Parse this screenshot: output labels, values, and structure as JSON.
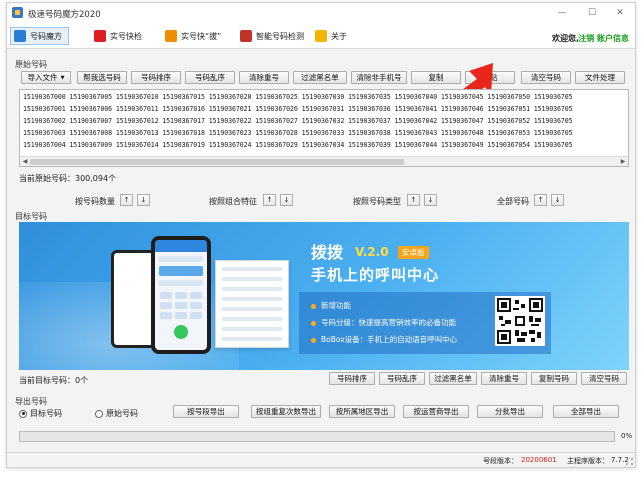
{
  "window": {
    "title": "极速号码魔方2020",
    "controls": [
      "—",
      "☐",
      "✕"
    ]
  },
  "tabs": [
    {
      "label": "号码魔方",
      "icon": "cube-icon",
      "color": "#2b7cd3",
      "active": true
    },
    {
      "label": "实号快检",
      "icon": "phone-check-icon",
      "color": "#e02020",
      "active": false
    },
    {
      "label": "实号快“拔”",
      "icon": "pull-icon",
      "color": "#f08c00",
      "active": false
    },
    {
      "label": "智能号码检测",
      "icon": "hourglass-icon",
      "color": "#c0332b",
      "active": false
    },
    {
      "label": "关于",
      "icon": "info-icon",
      "color": "#f2b600",
      "active": false
    }
  ],
  "header": {
    "welcome": "欢迎您,",
    "register": "注销 账户信息"
  },
  "original": {
    "group_label": "原始号码",
    "buttons": [
      "导入文件",
      "帮我选号码",
      "号码排序",
      "号码乱序",
      "清除重号",
      "过滤黑名单",
      "清除非手机号",
      "复制",
      "粘贴",
      "清空号码",
      "文件处理"
    ],
    "rows": [
      "15190367000 15190367005 15190367010 15190367015 15190367020 15190367025 15190367030 15190367035 15190367040 15190367045 15190367050 1519036705",
      "15190367001 15190367006 15190367011 15190367016 15190367021 15190367026 15190367031 15190367036 15190367041 15190367046 15190367051 1519036705",
      "15190367002 15190367007 15190367012 15190367017 15190367022 15190367027 15190367032 15190367037 15190367042 15190367047 15190367052 1519036705",
      "15190367003 15190367008 15190367013 15190367018 15190367023 15190367028 15190367033 15190367038 15190367043 15190367048 15190367053 1519036705",
      "15190367004 15190367009 15190367014 15190367019 15190367024 15190367029 15190367034 15190367039 15190367044 15190367049 15190367054 1519036705"
    ],
    "count_text": "当前原始号码：300,094个"
  },
  "sorting": [
    {
      "label": "按号码数量"
    },
    {
      "label": "按照组合特征"
    },
    {
      "label": "按照号码类型"
    },
    {
      "label": "全部号码"
    }
  ],
  "arrows": {
    "up": "↑",
    "down": "↓"
  },
  "target": {
    "group_label": "目标号码",
    "count_text": "当前目标号码：0个",
    "buttons": [
      "号码排序",
      "号码乱序",
      "过滤黑名单",
      "清除重号",
      "复制号码",
      "清空号码"
    ]
  },
  "banner": {
    "title": "拨拨",
    "version": "V.2.0",
    "tag": "安卓版",
    "subtitle": "手机上的呼叫中心",
    "features": [
      "新增功能",
      "号码分级：快速提高营销效率的必备功能",
      "BoBox设备：手机上的自动语音呼叫中心"
    ]
  },
  "export": {
    "group_label": "导出号码",
    "radios": [
      {
        "label": "目标号码",
        "checked": true
      },
      {
        "label": "原始号码",
        "checked": false
      }
    ],
    "buttons": [
      "按号段导出",
      "按组重复次数导出",
      "按所属地区导出",
      "按运营商导出",
      "分批导出",
      "全部导出"
    ]
  },
  "progress": {
    "value": 0,
    "label": "0%"
  },
  "status": {
    "version_label": "号段版本：",
    "version_value": "20200601",
    "main_label": "主程序版本：",
    "main_value": "7.7.2"
  }
}
